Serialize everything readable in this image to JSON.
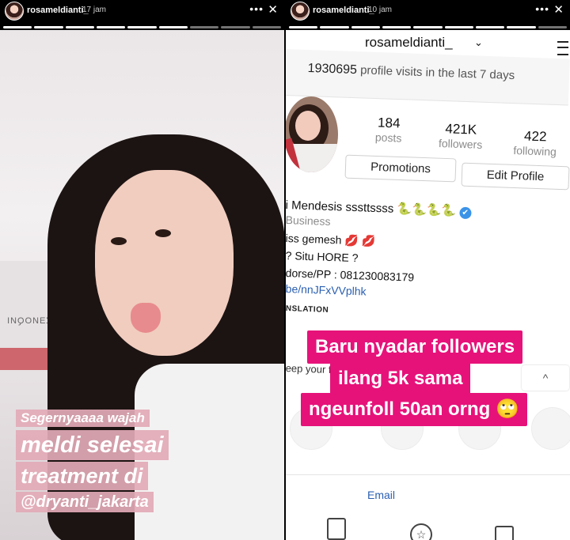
{
  "left_story": {
    "username": "rosameldianti_",
    "time": "17 jam",
    "more_label": "•••",
    "close_label": "✕",
    "wall_text": "IAIZƎИOQИI",
    "caption_lines": [
      "Segernyaaaa wajah",
      "meldi selesai",
      "treatment di",
      "@dryanti_jakarta"
    ],
    "caption_color": "#e2aab6"
  },
  "right_story": {
    "username": "rosameldianti_",
    "time": "10 jam",
    "more_label": "•••",
    "close_label": "✕",
    "profile_name": "rosameldianti_",
    "chevron": "⌄",
    "profile_visits_count": "1930695",
    "profile_visits_text": "profile visits in the last 7 days",
    "stats": [
      {
        "number": "184",
        "label": "posts"
      },
      {
        "number": "421K",
        "label": "followers"
      },
      {
        "number": "422",
        "label": "following"
      }
    ],
    "buttons": {
      "promotions": "Promotions",
      "edit_profile": "Edit Profile"
    },
    "bio": {
      "name_line": "i Mendesis sssttssss 🐍🐍🐍🐍",
      "verified_icon": "✔",
      "category": "Business",
      "line1": "iss gemesh 💋 💋",
      "line2": "? Situ HORE ?",
      "line3": "dorse/PP : 081230083179",
      "link": "be/nnJFxVVplhk",
      "translation": "NSLATION",
      "keep": "eep your fa"
    },
    "overlay_lines": [
      "Baru nyadar followers",
      "ilang 5k sama",
      "ngeunfoll 50an orng 🙄"
    ],
    "overlay_color": "#e6127a",
    "collapse_icon": "^",
    "email_label": "Email"
  }
}
